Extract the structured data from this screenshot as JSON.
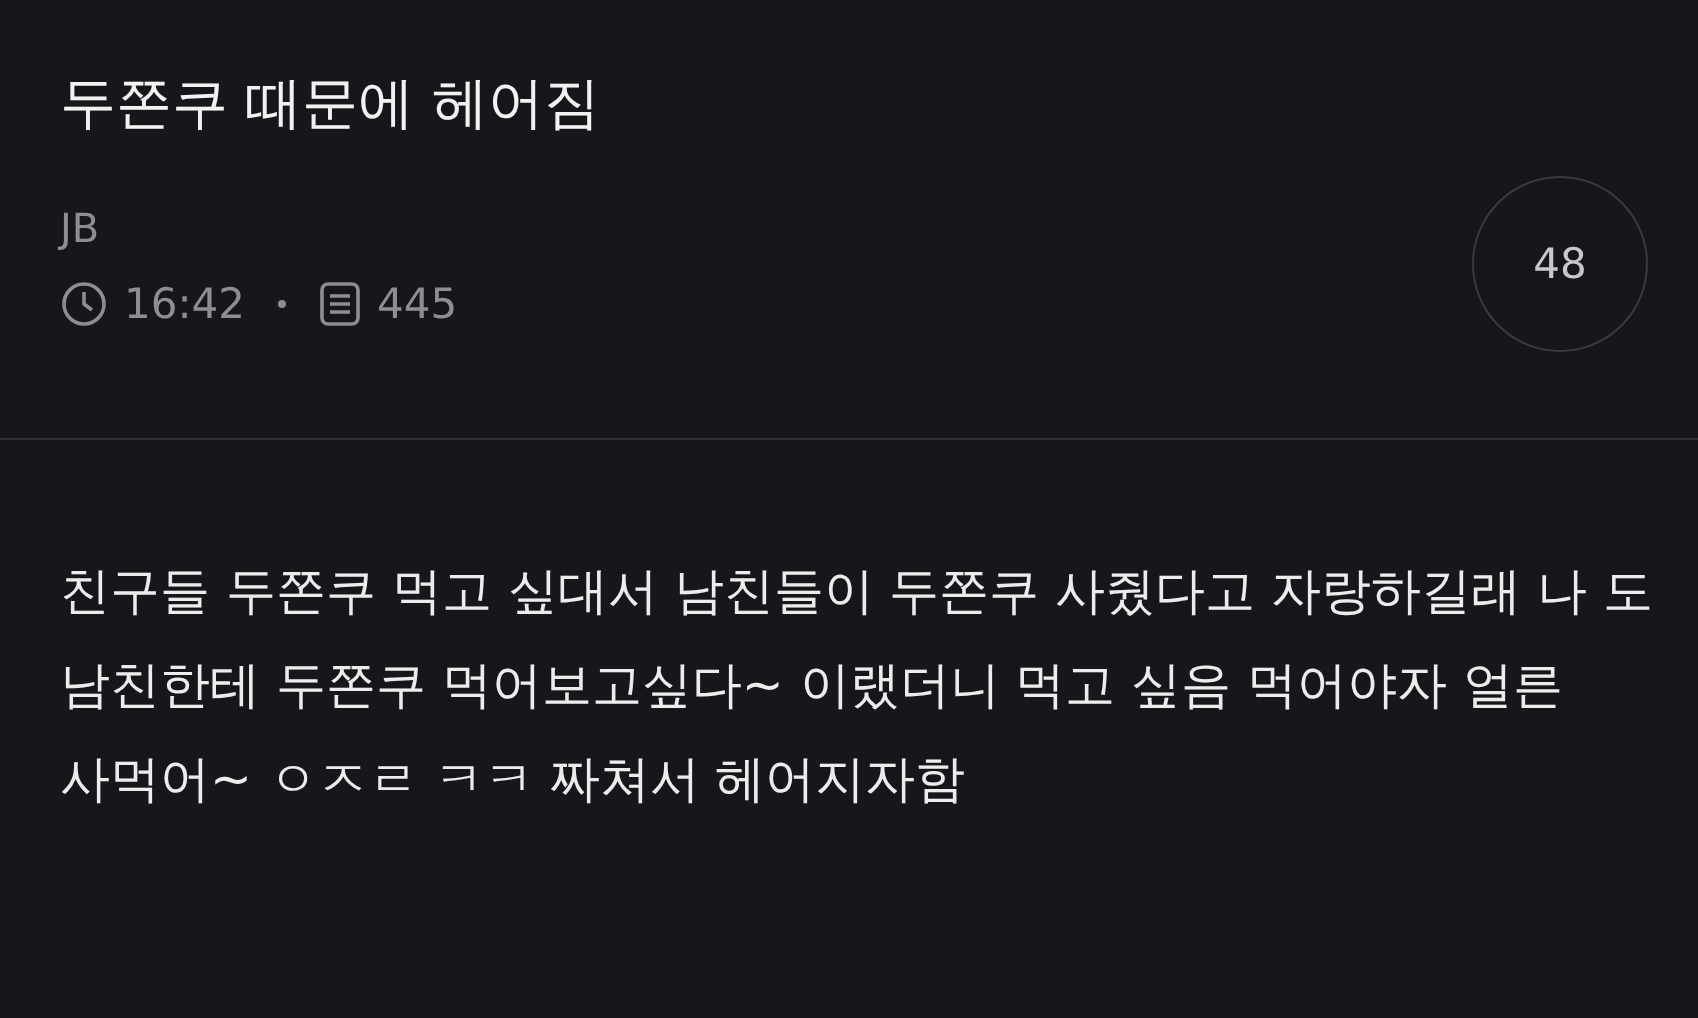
{
  "post": {
    "title": "두쫀쿠 때문에 헤어짐",
    "author": "JB",
    "time": "16:42",
    "views": "445",
    "comment_count": "48"
  },
  "body": "친구들 두쫀쿠 먹고 싶대서 남친들이 두쫀쿠 사줬다고 자랑하길래 나 도 남친한테 두쫀쿠 먹어보고싶다~ 이랬더니 먹고 싶음 먹어야자 얼른 사먹어~ ㅇㅈㄹ ㅋㅋ 짜쳐서 헤어지자함"
}
